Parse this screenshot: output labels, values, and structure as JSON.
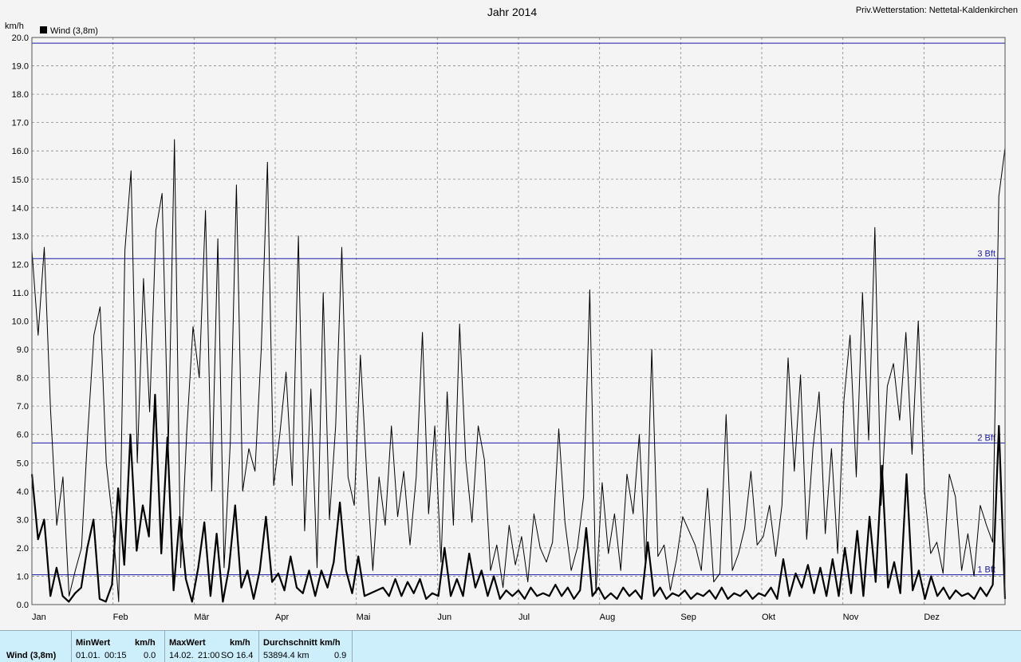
{
  "chart_data": {
    "type": "line",
    "title": "Jahr 2014",
    "station": "Priv.Wetterstation: Nettetal-Kaldenkirchen",
    "unit": "km/h",
    "ylim": [
      0,
      20
    ],
    "yticks": [
      "0.0",
      "1.0",
      "2.0",
      "3.0",
      "4.0",
      "5.0",
      "6.0",
      "7.0",
      "8.0",
      "9.0",
      "10.0",
      "11.0",
      "12.0",
      "13.0",
      "14.0",
      "15.0",
      "16.0",
      "17.0",
      "18.0",
      "19.0",
      "20.0"
    ],
    "months": [
      "Jan",
      "Feb",
      "Mär",
      "Apr",
      "Mai",
      "Jun",
      "Jul",
      "Aug",
      "Sep",
      "Okt",
      "Nov",
      "Dez"
    ],
    "legend": "Wind (3,8m)",
    "grid": true,
    "reference_lines": [
      {
        "label": "1 Bft",
        "value": 1.05
      },
      {
        "label": "2 Bft",
        "value": 5.7
      },
      {
        "label": "3 Bft",
        "value": 12.2
      },
      {
        "label": "",
        "value": 19.8
      }
    ],
    "series": [
      {
        "name": "Wind (3,8m) max",
        "style": "thin",
        "values": [
          12.5,
          9.5,
          12.6,
          6.9,
          2.8,
          4.5,
          0.3,
          1.2,
          2,
          6,
          9.5,
          10.5,
          5,
          3,
          0.1,
          12.5,
          15.3,
          5,
          11.5,
          6.8,
          13.2,
          14.5,
          5.5,
          16.4,
          1.3,
          6.2,
          9.8,
          8,
          13.9,
          4,
          12.9,
          1.3,
          5.7,
          14.8,
          4,
          5.5,
          4.7,
          9,
          15.6,
          4.2,
          6,
          8.2,
          4.2,
          13,
          2.6,
          7.6,
          1.3,
          11,
          3,
          6.3,
          12.6,
          4.5,
          3.5,
          8.8,
          4.7,
          1.2,
          4.5,
          2.8,
          6.3,
          3.1,
          4.7,
          2.1,
          4.5,
          9.6,
          3.2,
          6.3,
          1.5,
          7.5,
          2.8,
          9.9,
          5.1,
          2.9,
          6.3,
          5.1,
          1.2,
          2.1,
          0.6,
          2.8,
          1.4,
          2.4,
          0.8,
          3.2,
          2,
          1.5,
          2.2,
          6.2,
          2.9,
          1.2,
          2,
          3.8,
          11.1,
          0.4,
          4.3,
          1.8,
          3.2,
          1.2,
          4.6,
          3.2,
          6,
          1.3,
          9,
          1.7,
          2.1,
          0.5,
          1.6,
          3.1,
          2.6,
          2.1,
          1.2,
          4.1,
          0.8,
          1.1,
          6.7,
          1.2,
          1.8,
          2.7,
          4.7,
          2.1,
          2.4,
          3.5,
          1.7,
          3.5,
          8.7,
          4.7,
          8.1,
          2.3,
          5.5,
          7.5,
          2.5,
          5.5,
          1.8,
          7.2,
          9.5,
          4.5,
          11,
          5.8,
          13.3,
          3.5,
          7.7,
          8.5,
          6.5,
          9.6,
          5.3,
          10,
          4,
          1.8,
          2.2,
          1.1,
          4.6,
          3.8,
          1.2,
          2.5,
          1,
          3.5,
          2.8,
          2.2,
          14.4,
          16.1
        ]
      },
      {
        "name": "Wind (3,8m) avg",
        "style": "thick",
        "values": [
          4.6,
          2.3,
          3,
          0.3,
          1.3,
          0.3,
          0.1,
          0.4,
          0.6,
          2,
          3,
          0.2,
          0.1,
          0.7,
          4.1,
          1.4,
          6,
          1.9,
          3.5,
          2.4,
          7.4,
          1.8,
          5.9,
          0.5,
          3.1,
          0.9,
          0.1,
          1.3,
          2.9,
          0.3,
          2.5,
          0.1,
          1.3,
          3.5,
          0.6,
          1.2,
          0.2,
          1.2,
          3.1,
          0.8,
          1.1,
          0.5,
          1.7,
          0.6,
          0.4,
          1.2,
          0.3,
          1.2,
          0.6,
          1.5,
          3.6,
          1.2,
          0.4,
          1.7,
          0.3,
          0.4,
          0.5,
          0.6,
          0.3,
          0.9,
          0.3,
          0.8,
          0.4,
          0.9,
          0.2,
          0.4,
          0.3,
          2,
          0.3,
          0.9,
          0.3,
          1.8,
          0.6,
          1.2,
          0.3,
          1,
          0.2,
          0.5,
          0.3,
          0.5,
          0.2,
          0.6,
          0.3,
          0.4,
          0.3,
          0.7,
          0.3,
          0.6,
          0.2,
          0.5,
          2.7,
          0.3,
          0.6,
          0.2,
          0.4,
          0.2,
          0.6,
          0.3,
          0.5,
          0.2,
          2.2,
          0.3,
          0.6,
          0.2,
          0.4,
          0.3,
          0.5,
          0.2,
          0.4,
          0.3,
          0.5,
          0.2,
          0.6,
          0.2,
          0.4,
          0.3,
          0.5,
          0.2,
          0.4,
          0.3,
          0.6,
          0.2,
          1.6,
          0.3,
          1.1,
          0.6,
          1.4,
          0.4,
          1.3,
          0.3,
          1.6,
          0.3,
          2,
          0.4,
          2.6,
          0.3,
          3.1,
          0.8,
          4.9,
          0.6,
          1.5,
          0.4,
          4.6,
          0.5,
          1.2,
          0.2,
          1,
          0.3,
          0.6,
          0.2,
          0.5,
          0.3,
          0.4,
          0.2,
          0.6,
          0.3,
          0.7,
          6.3,
          0.2
        ]
      }
    ],
    "stats": {
      "series_label": "Wind (3,8m)",
      "min_header": "MinWert",
      "max_header": "MaxWert",
      "avg_header": "Durchschnitt km/h",
      "unit_header": "km/h",
      "min_date": "01.01.",
      "min_time": "00:15",
      "min_value": "0.0",
      "max_date": "14.02.",
      "max_time": "21:00",
      "max_dir": "SO",
      "max_value": "16.4",
      "total": "53894.4 km",
      "avg_value": "0.9"
    },
    "colors": {
      "background": "#f4f4f4",
      "grid": "#888888",
      "reference": "#1a1aa8",
      "line": "#000000",
      "footer": "#cdeefb"
    }
  }
}
